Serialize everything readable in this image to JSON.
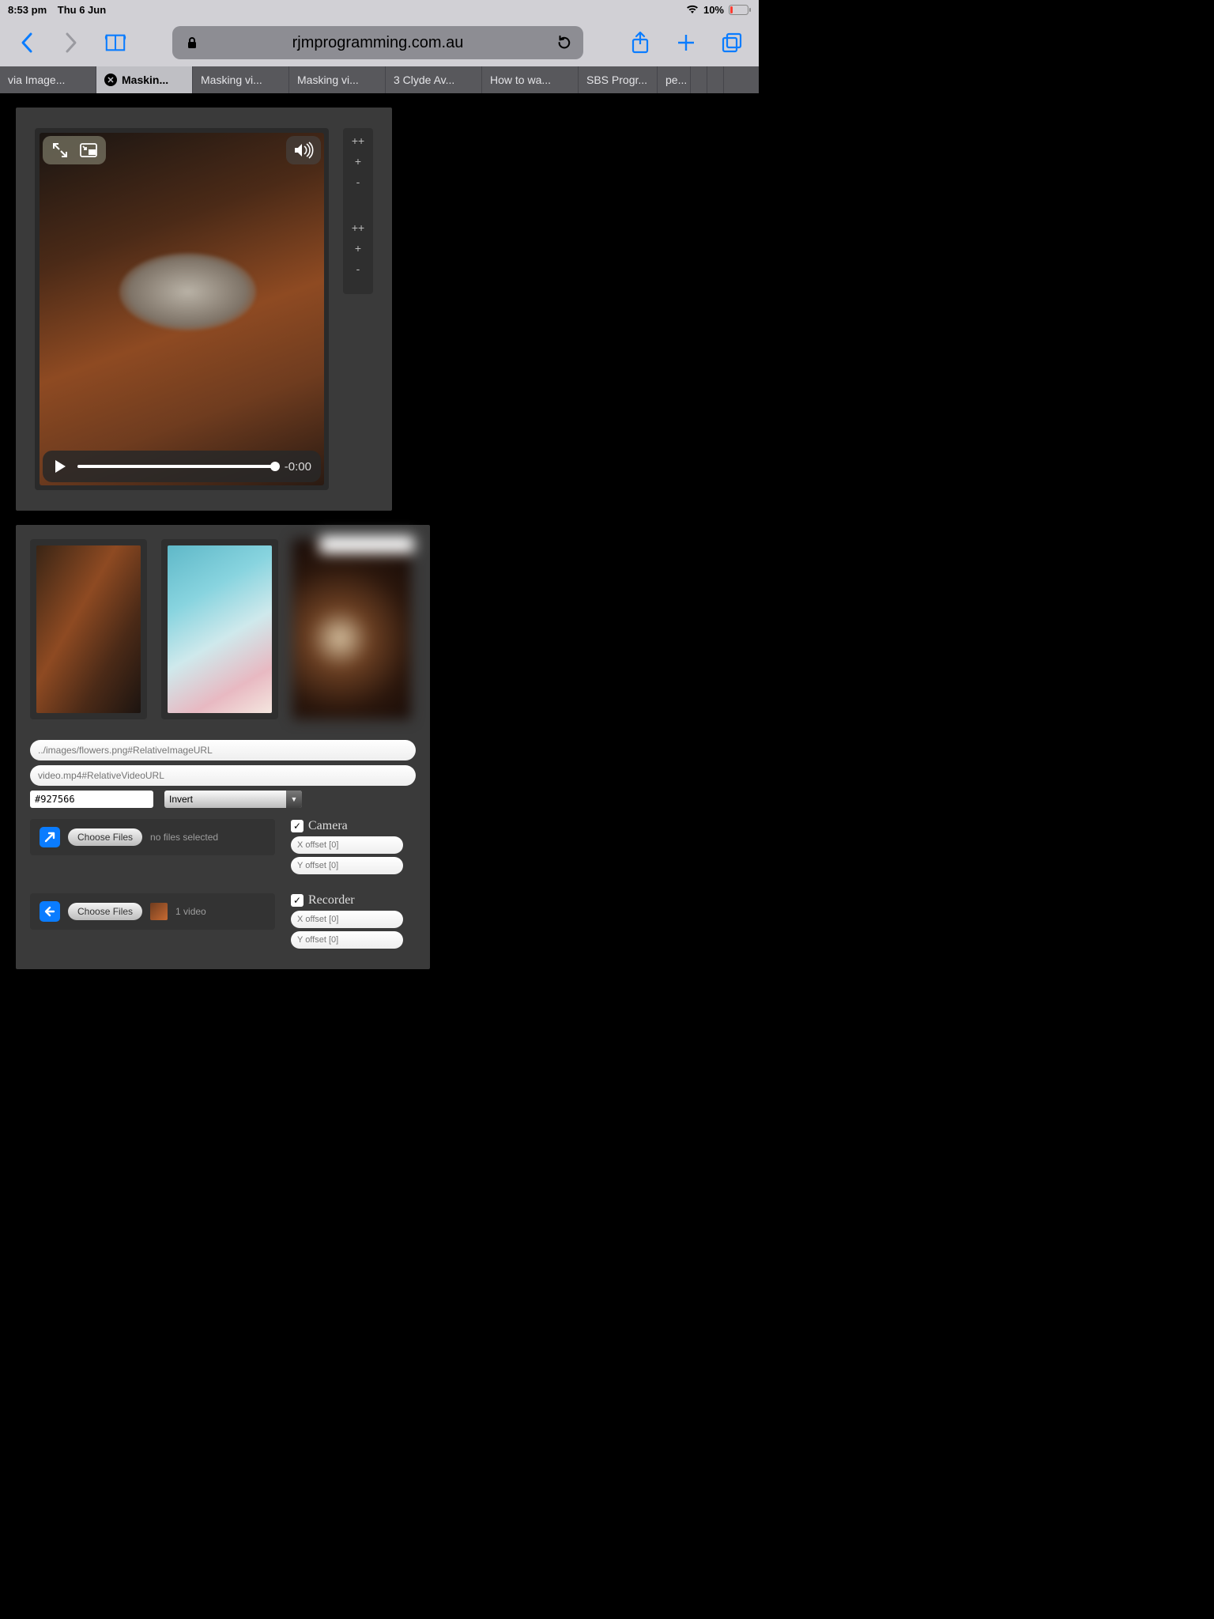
{
  "status": {
    "time": "8:53 pm",
    "date": "Thu 6 Jun",
    "battery": "10%"
  },
  "toolbar": {
    "domain": "rjmprogramming.com.au"
  },
  "tabs": [
    {
      "label": "via Image..."
    },
    {
      "label": "Maskin..."
    },
    {
      "label": "Masking vi..."
    },
    {
      "label": "Masking vi..."
    },
    {
      "label": "3 Clyde Av..."
    },
    {
      "label": "How to wa..."
    },
    {
      "label": "SBS Progr..."
    },
    {
      "label": "pe..."
    }
  ],
  "video": {
    "time_remaining": "-0:00"
  },
  "zoom": {
    "a_pp": "++",
    "a_p": "+",
    "a_m": "-",
    "b_pp": "++",
    "b_p": "+",
    "b_m": "-"
  },
  "inputs": {
    "image_url_placeholder": "../images/flowers.png#RelativeImageURL",
    "video_url_placeholder": "video.mp4#RelativeVideoURL",
    "color_value": "#927566",
    "filter_value": "Invert"
  },
  "file1": {
    "button": "Choose Files",
    "status": "no files selected"
  },
  "file2": {
    "button": "Choose Files",
    "status": "1 video"
  },
  "camera": {
    "label": "Camera",
    "x_placeholder": "X offset [0]",
    "y_placeholder": "Y offset [0]"
  },
  "recorder": {
    "label": "Recorder",
    "x_placeholder": "X offset [0]",
    "y_placeholder": "Y offset [0]"
  }
}
